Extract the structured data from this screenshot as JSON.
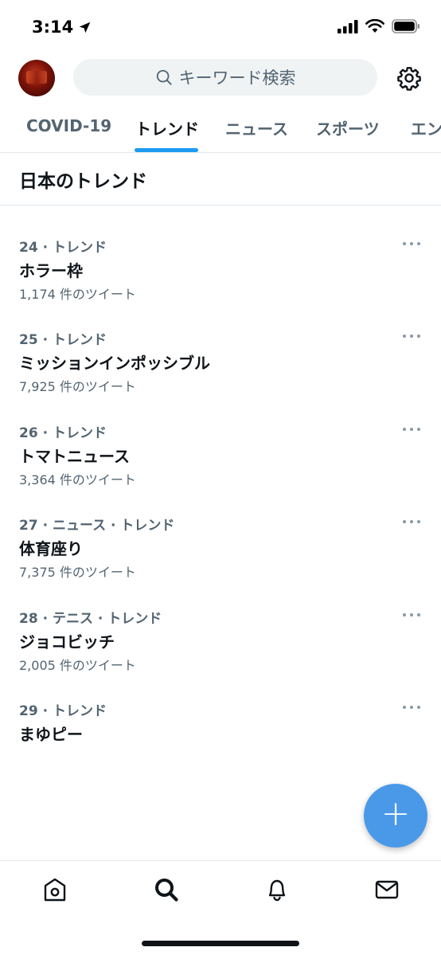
{
  "status_bar": {
    "time": "3:14"
  },
  "search": {
    "placeholder": "キーワード検索"
  },
  "tabs": [
    {
      "label": "COVID-19"
    },
    {
      "label": "トレンド",
      "active": true
    },
    {
      "label": "ニュース"
    },
    {
      "label": "スポーツ"
    },
    {
      "label": "エン"
    }
  ],
  "section": {
    "title": "日本のトレンド"
  },
  "trends": [
    {
      "context": "24 · トレンド",
      "name": "ホラー枠",
      "count": "1,174 件のツイート"
    },
    {
      "context": "25 · トレンド",
      "name": "ミッションインポッシブル",
      "count": "7,925 件のツイート"
    },
    {
      "context": "26 · トレンド",
      "name": "トマトニュース",
      "count": "3,364 件のツイート"
    },
    {
      "context": "27 · ニュース · トレンド",
      "name": "体育座り",
      "count": "7,375 件のツイート"
    },
    {
      "context": "28 · テニス · トレンド",
      "name": "ジョコビッチ",
      "count": "2,005 件のツイート"
    },
    {
      "context": "29 · トレンド",
      "name": "まゆピー",
      "count": ""
    }
  ],
  "fab": {
    "label": "+"
  },
  "icons": {
    "location": "location-arrow-icon",
    "signal": "cellular-signal-icon",
    "wifi": "wifi-icon",
    "battery": "battery-icon",
    "search": "search-icon",
    "settings": "gear-icon",
    "more": "more-dots-icon",
    "home": "home-icon",
    "explore": "search-icon",
    "notifications": "bell-icon",
    "messages": "mail-icon"
  },
  "colors": {
    "accent": "#1d9bf0",
    "fab": "#4a99e9",
    "secondary_text": "#536471",
    "primary_text": "#0f1419"
  }
}
